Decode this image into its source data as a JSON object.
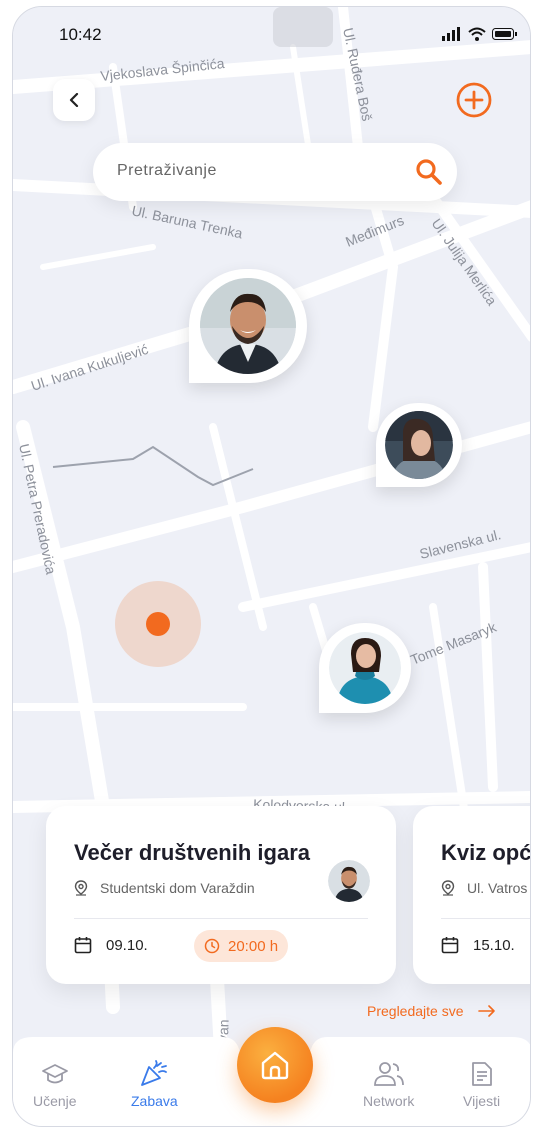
{
  "status": {
    "time": "10:42"
  },
  "map": {
    "streets": [
      "Vjekoslava Špinčića",
      "Ul. Ruđera Boš",
      "Ul. Baruna Trenka",
      "Međimurs",
      "Ul. Julija Merlića",
      "Ul. Ivana Kukuljević",
      "Ul. Petra Preradovića",
      "Slavenska ul.",
      "Tome Masaryk",
      "Kolodvorska ul.",
      "Ul. Ivan"
    ]
  },
  "search": {
    "placeholder": "Pretraživanje"
  },
  "events": [
    {
      "title": "Večer društvenih igara",
      "location": "Studentski dom Varaždin",
      "date": "09.10.",
      "time": "20:00 h"
    },
    {
      "title": "Kviz opće",
      "location": "Ul. Vatros",
      "date": "15.10."
    }
  ],
  "see_all_label": "Pregledajte sve",
  "tabs": [
    {
      "label": "Učenje",
      "icon": "graduation-cap-icon"
    },
    {
      "label": "Zabava",
      "icon": "party-popper-icon",
      "active": true
    },
    {
      "label": "Home",
      "icon": "home-icon"
    },
    {
      "label": "Network",
      "icon": "people-icon"
    },
    {
      "label": "Vijesti",
      "icon": "document-icon"
    }
  ],
  "colors": {
    "accent": "#f26a1f",
    "active_tab": "#3a7bea",
    "map_bg": "#eef0f7"
  }
}
